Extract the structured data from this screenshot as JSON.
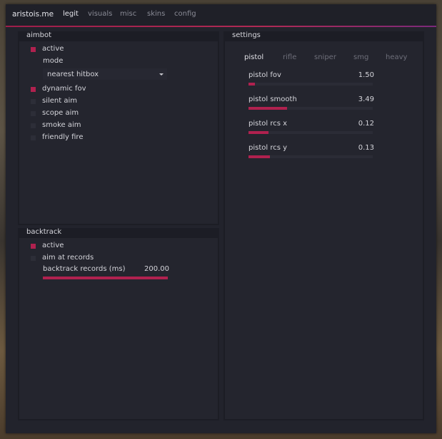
{
  "app": {
    "brand": "aristois.me",
    "tabs": [
      {
        "label": "legit",
        "active": true
      },
      {
        "label": "visuals",
        "active": false
      },
      {
        "label": "misc",
        "active": false
      },
      {
        "label": "skins",
        "active": false
      },
      {
        "label": "config",
        "active": false
      }
    ]
  },
  "colors": {
    "accent": "#b0214f",
    "window_bg": "#22232c",
    "panel_bg": "#1c1d25"
  },
  "aimbot": {
    "title": "aimbot",
    "active_label": "active",
    "active_checked": true,
    "mode_label": "mode",
    "mode_value": "nearest hitbox",
    "options": [
      {
        "label": "dynamic fov",
        "checked": true
      },
      {
        "label": "silent aim",
        "checked": false
      },
      {
        "label": "scope aim",
        "checked": false
      },
      {
        "label": "smoke aim",
        "checked": false
      },
      {
        "label": "friendly fire",
        "checked": false
      }
    ]
  },
  "backtrack": {
    "title": "backtrack",
    "active_label": "active",
    "active_checked": true,
    "aim_records_label": "aim at records",
    "aim_records_checked": false,
    "records_label": "backtrack records (ms)",
    "records_value": "200.00",
    "records_fraction": 1.0
  },
  "settings": {
    "title": "settings",
    "weapon_tabs": [
      {
        "label": "pistol",
        "active": true
      },
      {
        "label": "rifle",
        "active": false
      },
      {
        "label": "sniper",
        "active": false
      },
      {
        "label": "smg",
        "active": false
      },
      {
        "label": "heavy",
        "active": false
      }
    ],
    "sliders": [
      {
        "label": "pistol fov",
        "value": "1.50",
        "fraction": 0.05
      },
      {
        "label": "pistol smooth",
        "value": "3.49",
        "fraction": 0.31
      },
      {
        "label": "pistol rcs x",
        "value": "0.12",
        "fraction": 0.16
      },
      {
        "label": "pistol rcs y",
        "value": "0.13",
        "fraction": 0.17
      }
    ]
  }
}
